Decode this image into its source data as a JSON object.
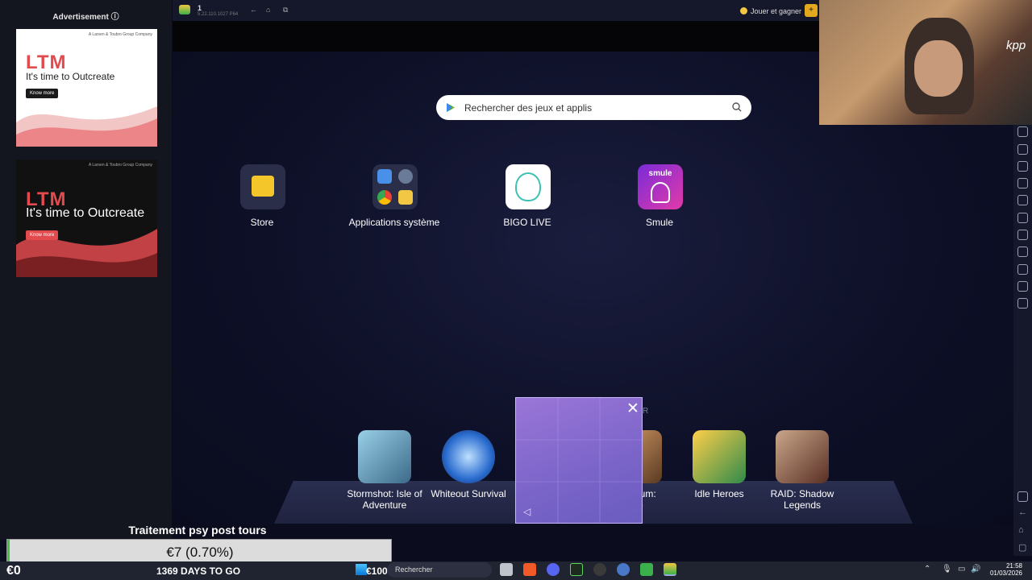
{
  "ad": {
    "title": "Advertisement",
    "cards": [
      {
        "brand": "LTM",
        "tagline": "It's time to Outcreate",
        "button": "Know more",
        "corner": "A Larsen & Toubro Group Company"
      },
      {
        "brand": "LTM",
        "tagline": "It's time to Outcreate",
        "button": "Know more",
        "corner": "A Larsen & Toubro Group Company"
      }
    ]
  },
  "emulator": {
    "instance": "1",
    "version": "5.22.110.1027 P64",
    "play_earn": "Jouer et gagner"
  },
  "search": {
    "placeholder": "Rechercher des jeux et applis"
  },
  "apps": [
    {
      "label": "Store",
      "icon": "store-bag-icon"
    },
    {
      "label": "Applications système",
      "icon": "system-apps-icon"
    },
    {
      "label": "BIGO LIVE",
      "icon": "bigo-live-icon"
    },
    {
      "label": "Smule",
      "icon": "smule-icon",
      "badge": "smule"
    }
  ],
  "games": [
    {
      "label_1": "Stormshot: Isle of",
      "label_2": "Adventure"
    },
    {
      "label_1": "Whiteout Survival",
      "label_2": ""
    },
    {
      "label_1": "lum:",
      "label_2": "e"
    },
    {
      "label_1": "Idle Heroes",
      "label_2": ""
    },
    {
      "label_1": "RAID: Shadow",
      "label_2": "Legends"
    }
  ],
  "popup_peek": "R",
  "overlay": {
    "goal_title": "Traitement psy post tours",
    "goal_value": "€7 (0.70%)",
    "goal_progress": 0.007,
    "left_amount": "€0",
    "right_amount": "€1000",
    "days_to_go": "1369 DAYS TO GO"
  },
  "taskbar": {
    "search": "Rechercher",
    "time": "21:58",
    "date": "01/03/2026"
  },
  "webcam": {
    "sign": "kpp"
  },
  "colors": {
    "accent": "#e24a4d",
    "progress": "#3fbf4f",
    "emulator_bg": "#0d0f26"
  }
}
